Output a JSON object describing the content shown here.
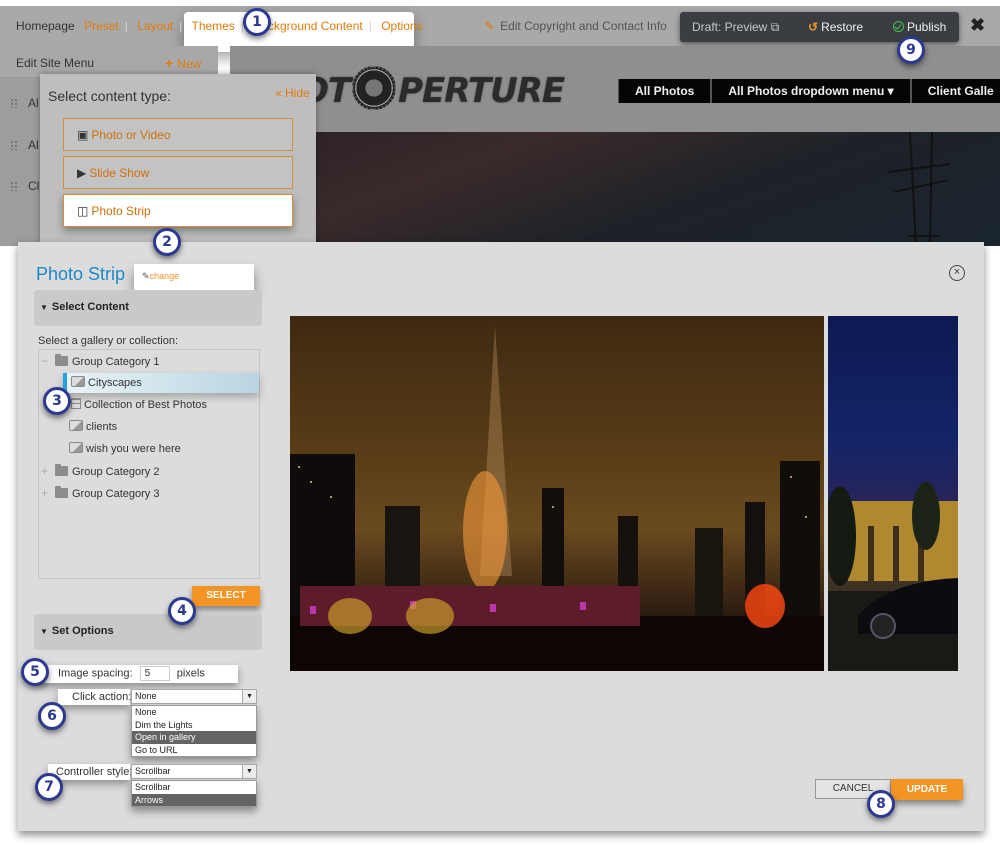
{
  "admin_bar": {
    "homepage": "Homepage",
    "nav_links": [
      "Preset",
      "Layout",
      "Themes",
      "Background Content",
      "Options"
    ],
    "edit_copyright": "Edit Copyright and Contact Info",
    "draft_preview": "Draft: Preview",
    "restore": "Restore",
    "publish": "Publish",
    "close_glyph": "✖"
  },
  "site_preview": {
    "logo_text_left": "OT",
    "logo_text_right": "PERTURE",
    "menu": [
      "All Photos",
      "All Photos dropdown menu ▾",
      "Client Galle"
    ]
  },
  "sidebar": {
    "title": "Edit Site Menu",
    "new_label": "New",
    "items": [
      "Al",
      "Al",
      "Cl"
    ]
  },
  "content_type_panel": {
    "title": "Select content type:",
    "hide_label": "« Hide",
    "options": [
      {
        "label": "Photo or Video",
        "icon": "image-icon",
        "selected": false
      },
      {
        "label": "Slide Show",
        "icon": "play-icon",
        "selected": false
      },
      {
        "label": "Photo Strip",
        "icon": "columns-icon",
        "selected": true
      }
    ]
  },
  "modal": {
    "title": "Photo Strip",
    "change_label": "change",
    "select_content_header": "Select Content",
    "gallery_prompt": "Select a gallery or collection:",
    "tree": [
      {
        "label": "Group Category 1",
        "type": "folder",
        "expander": "−",
        "level": 0
      },
      {
        "label": "Cityscapes",
        "type": "gallery",
        "level": 1,
        "selected": true
      },
      {
        "label": "Collection of Best Photos",
        "type": "collection",
        "level": 1
      },
      {
        "label": "clients",
        "type": "gallery",
        "level": 1
      },
      {
        "label": "wish you were here",
        "type": "gallery",
        "level": 1
      },
      {
        "label": "Group Category 2",
        "type": "folder",
        "expander": "+",
        "level": 0
      },
      {
        "label": "Group Category 3",
        "type": "folder",
        "expander": "+",
        "level": 0
      }
    ],
    "select_button": "SELECT",
    "set_options_header": "Set Options",
    "image_spacing_label": "Image spacing:",
    "image_spacing_value": "5",
    "image_spacing_unit": "pixels",
    "click_action_label": "Click action:",
    "click_action_value": "None",
    "click_action_options": [
      "None",
      "Dim the Lights",
      "Open in gallery",
      "Go to URL"
    ],
    "click_action_highlighted": "Open in gallery",
    "controller_style_label": "Controller style:",
    "controller_style_value": "Scrollbar",
    "controller_style_options": [
      "Scrollbar",
      "Arrows"
    ],
    "controller_style_highlighted": "Arrows",
    "cancel_button": "CANCEL",
    "update_button": "UPDATE",
    "close_glyph": "×"
  },
  "callouts": [
    "1",
    "2",
    "3",
    "4",
    "5",
    "6",
    "7",
    "8",
    "9"
  ],
  "colors": {
    "accent_orange": "#f39424",
    "link_orange": "#e07b0c",
    "title_blue": "#1c89c7",
    "callout_navy": "#2b3990",
    "selection_blue": "#27a2e0"
  }
}
